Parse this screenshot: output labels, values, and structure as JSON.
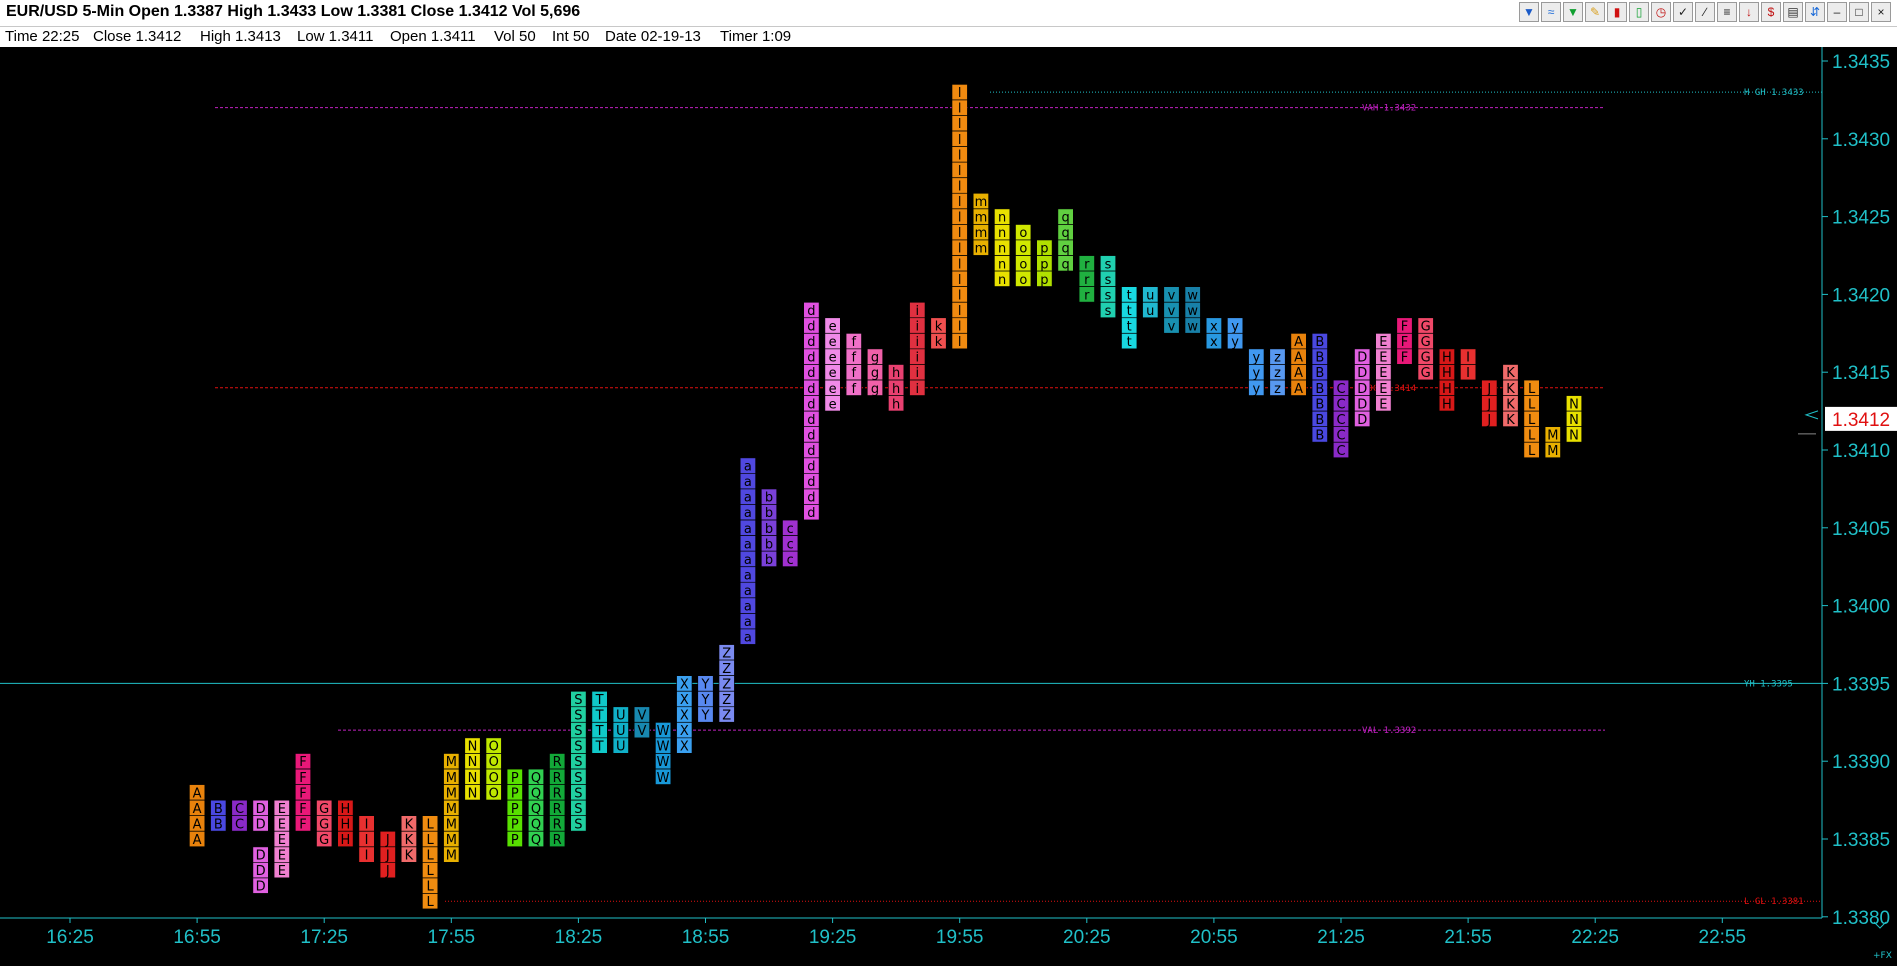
{
  "window": {
    "title": "EUR/USD 5-Min Open 1.3387 High 1.3433 Low 1.3381 Close 1.3412 Vol 5,696",
    "toolbar_icons": [
      "chart-style-icon",
      "wave-icon",
      "funnel-icon",
      "pencil-icon",
      "bars-icon",
      "candle-icon",
      "clock-icon",
      "check-tool-icon",
      "line-tool-icon",
      "fib-tool-icon",
      "arrow-down-icon",
      "dollar-icon",
      "trash-icon",
      "scroll-icon",
      "minimize-icon",
      "restore-icon",
      "close-icon"
    ]
  },
  "infobar": {
    "time": "Time 22:25",
    "close": "Close 1.3412",
    "high": "High 1.3413",
    "low": "Low 1.3411",
    "open": "Open 1.3411",
    "vol": "Vol 50",
    "int": "Int 50",
    "date": "Date 02-19-13",
    "timer": "Timer 1:09"
  },
  "chart_data": {
    "type": "table",
    "subtype": "market-profile-tpo",
    "symbol": "EUR/USD",
    "interval": "5-Min",
    "tick_size": 0.0001,
    "ylim": [
      1.3379,
      1.3436
    ],
    "y_ticks": [
      "1.3435",
      "1.3430",
      "1.3425",
      "1.3420",
      "1.3415",
      "1.3410",
      "1.3405",
      "1.3400",
      "1.3395",
      "1.3390",
      "1.3385",
      "1.3380"
    ],
    "x_ticks": [
      "16:25",
      "16:55",
      "17:25",
      "17:55",
      "18:25",
      "18:55",
      "19:25",
      "19:55",
      "20:25",
      "20:55",
      "21:25",
      "21:55",
      "22:25",
      "22:55"
    ],
    "current_price": "1.3412",
    "reference_lines": [
      {
        "label": "H GH 1.3433",
        "price": 1.3433,
        "color": "#20c0c8",
        "style": "dotted"
      },
      {
        "label": "VAH 1.3432",
        "price": 1.3432,
        "color": "#c020c0",
        "style": "dashed"
      },
      {
        "label": "POC 1.3414",
        "price": 1.3414,
        "color": "#e01010",
        "style": "dashed"
      },
      {
        "label": "YH 1.3395",
        "price": 1.3395,
        "color": "#20c0c8",
        "style": "solid"
      },
      {
        "label": "VAL 1.3392",
        "price": 1.3392,
        "color": "#c020c0",
        "style": "dashed"
      },
      {
        "label": "L GL 1.3381",
        "price": 1.3381,
        "color": "#e01010",
        "style": "dotted"
      }
    ],
    "letter_colors": {
      "A": "#e8820c",
      "B": "#4a48e0",
      "C": "#8a2ac8",
      "D": "#e060e0",
      "E": "#f080d0",
      "F": "#e81878",
      "G": "#f04868",
      "H": "#d81818",
      "I": "#e83030",
      "J": "#e02020",
      "K": "#f06a6a",
      "L": "#f08c10",
      "M": "#e8b000",
      "N": "#e8e000",
      "O": "#c0e800",
      "P": "#58e000",
      "Q": "#30d050",
      "R": "#12a838",
      "S": "#20d0a0",
      "T": "#10c8c8",
      "U": "#10b0c8",
      "V": "#1888b0",
      "W": "#1898d8",
      "X": "#3aa0f0",
      "Y": "#5888f0",
      "Z": "#7a8af0",
      "a": "#5048e0",
      "b": "#7a40d8",
      "c": "#a030d0",
      "d": "#e050e0",
      "e": "#f08ae8",
      "f": "#f070c8",
      "g": "#f060a8",
      "h": "#e84070",
      "i": "#e03040",
      "j": "#d81830",
      "k": "#f05050",
      "l": "#f08a10",
      "m": "#e8b000",
      "n": "#e8e000",
      "o": "#d0e800",
      "p": "#b0e000",
      "q": "#60d040",
      "r": "#20b040",
      "s": "#20d0b0",
      "t": "#18d8e0",
      "u": "#20b8d0",
      "v": "#1890b0",
      "w": "#1880a8",
      "x": "#2898e0",
      "y": "#4098f0",
      "z": "#5898f0"
    },
    "columns": [
      {
        "time": "16:55",
        "cells": {
          "1.3388": "A",
          "1.3387": "A",
          "1.3386": "A",
          "1.3385": "A"
        }
      },
      {
        "time": "17:00",
        "cells": {
          "1.3387": "B",
          "1.3386": "B"
        }
      },
      {
        "time": "17:05",
        "cells": {
          "1.3387": "C",
          "1.3386": "C"
        }
      },
      {
        "time": "17:10",
        "cells": {
          "1.3387": "D",
          "1.3386": "D",
          "1.3384": "D",
          "1.3383": "D",
          "1.3382": "D"
        }
      },
      {
        "time": "17:15",
        "cells": {
          "1.3387": "E",
          "1.3386": "E",
          "1.3385": "E",
          "1.3384": "E",
          "1.3383": "E"
        }
      },
      {
        "time": "17:20",
        "cells": {
          "1.3390": "F",
          "1.3389": "F",
          "1.3388": "F",
          "1.3387": "F",
          "1.3386": "F"
        }
      },
      {
        "time": "17:25",
        "cells": {
          "1.3387": "G",
          "1.3386": "G",
          "1.3385": "G"
        }
      },
      {
        "time": "17:30",
        "cells": {
          "1.3387": "H",
          "1.3386": "H",
          "1.3385": "H"
        }
      },
      {
        "time": "17:35",
        "cells": {
          "1.3386": "I",
          "1.3385": "I",
          "1.3384": "I"
        }
      },
      {
        "time": "17:40",
        "cells": {
          "1.3385": "J",
          "1.3384": "J",
          "1.3383": "J"
        }
      },
      {
        "time": "17:45",
        "cells": {
          "1.3386": "K",
          "1.3385": "K",
          "1.3384": "K"
        }
      },
      {
        "time": "17:50",
        "cells": {
          "1.3386": "L",
          "1.3385": "L",
          "1.3384": "L",
          "1.3383": "L",
          "1.3382": "L",
          "1.3381": "L"
        }
      },
      {
        "time": "17:55",
        "cells": {
          "1.3390": "M",
          "1.3389": "M",
          "1.3388": "M",
          "1.3387": "M",
          "1.3386": "M",
          "1.3385": "M",
          "1.3384": "M"
        }
      },
      {
        "time": "18:00",
        "cells": {
          "1.3391": "N",
          "1.3390": "N",
          "1.3389": "N",
          "1.3388": "N"
        }
      },
      {
        "time": "18:05",
        "cells": {
          "1.3391": "O",
          "1.3390": "O",
          "1.3389": "O",
          "1.3388": "O"
        }
      },
      {
        "time": "18:10",
        "cells": {
          "1.3389": "P",
          "1.3388": "P",
          "1.3387": "P",
          "1.3386": "P",
          "1.3385": "P"
        }
      },
      {
        "time": "18:15",
        "cells": {
          "1.3389": "Q",
          "1.3388": "Q",
          "1.3387": "Q",
          "1.3386": "Q",
          "1.3385": "Q"
        }
      },
      {
        "time": "18:20",
        "cells": {
          "1.3390": "R",
          "1.3389": "R",
          "1.3388": "R",
          "1.3387": "R",
          "1.3386": "R",
          "1.3385": "R"
        }
      },
      {
        "time": "18:25",
        "cells": {
          "1.3394": "S",
          "1.3393": "S",
          "1.3392": "S",
          "1.3391": "S",
          "1.3390": "S",
          "1.3389": "S",
          "1.3388": "S",
          "1.3387": "S",
          "1.3386": "S"
        }
      },
      {
        "time": "18:30",
        "cells": {
          "1.3394": "T",
          "1.3393": "T",
          "1.3392": "T",
          "1.3391": "T"
        }
      },
      {
        "time": "18:35",
        "cells": {
          "1.3393": "U",
          "1.3392": "U",
          "1.3391": "U"
        }
      },
      {
        "time": "18:40",
        "cells": {
          "1.3393": "V",
          "1.3392": "V"
        }
      },
      {
        "time": "18:45",
        "cells": {
          "1.3392": "W",
          "1.3391": "W",
          "1.3390": "W",
          "1.3389": "W"
        }
      },
      {
        "time": "18:50",
        "cells": {
          "1.3395": "X",
          "1.3394": "X",
          "1.3393": "X",
          "1.3392": "X",
          "1.3391": "X"
        }
      },
      {
        "time": "18:55",
        "cells": {
          "1.3395": "Y",
          "1.3394": "Y",
          "1.3393": "Y"
        }
      },
      {
        "time": "19:00",
        "cells": {
          "1.3397": "Z",
          "1.3396": "Z",
          "1.3395": "Z",
          "1.3394": "Z",
          "1.3393": "Z"
        }
      },
      {
        "time": "19:05",
        "cells": {
          "1.3409": "a",
          "1.3408": "a",
          "1.3407": "a",
          "1.3406": "a",
          "1.3405": "a",
          "1.3404": "a",
          "1.3403": "a",
          "1.3402": "a",
          "1.3401": "a",
          "1.3400": "a",
          "1.3399": "a",
          "1.3398": "a"
        }
      },
      {
        "time": "19:10",
        "cells": {
          "1.3407": "b",
          "1.3406": "b",
          "1.3405": "b",
          "1.3404": "b",
          "1.3403": "b"
        }
      },
      {
        "time": "19:15",
        "cells": {
          "1.3405": "c",
          "1.3404": "c",
          "1.3403": "c"
        }
      },
      {
        "time": "19:20",
        "cells": {
          "1.3419": "d",
          "1.3418": "d",
          "1.3417": "d",
          "1.3416": "d",
          "1.3415": "d",
          "1.3414": "d",
          "1.3413": "d",
          "1.3412": "d",
          "1.3411": "d",
          "1.3410": "d",
          "1.3409": "d",
          "1.3408": "d",
          "1.3407": "d",
          "1.3406": "d"
        }
      },
      {
        "time": "19:25",
        "cells": {
          "1.3418": "e",
          "1.3417": "e",
          "1.3416": "e",
          "1.3415": "e",
          "1.3414": "e",
          "1.3413": "e"
        }
      },
      {
        "time": "19:30",
        "cells": {
          "1.3417": "f",
          "1.3416": "f",
          "1.3415": "f",
          "1.3414": "f"
        }
      },
      {
        "time": "19:35",
        "cells": {
          "1.3416": "g",
          "1.3415": "g",
          "1.3414": "g"
        }
      },
      {
        "time": "19:40",
        "cells": {
          "1.3415": "h",
          "1.3414": "h",
          "1.3413": "h"
        }
      },
      {
        "time": "19:45",
        "cells": {
          "1.3419": "i",
          "1.3418": "i",
          "1.3417": "i",
          "1.3416": "i",
          "1.3415": "i",
          "1.3414": "i"
        }
      },
      {
        "time": "19:50",
        "cells": {
          "1.3418": "k",
          "1.3417": "k"
        }
      },
      {
        "time": "19:55",
        "cells": {
          "1.3433": "l",
          "1.3432": "l",
          "1.3431": "l",
          "1.3430": "l",
          "1.3429": "l",
          "1.3428": "l",
          "1.3427": "l",
          "1.3426": "l",
          "1.3425": "l",
          "1.3424": "l",
          "1.3423": "l",
          "1.3422": "l",
          "1.3421": "l",
          "1.3420": "l",
          "1.3419": "l",
          "1.3418": "l",
          "1.3417": "l"
        }
      },
      {
        "time": "20:00",
        "cells": {
          "1.3426": "m",
          "1.3425": "m",
          "1.3424": "m",
          "1.3423": "m"
        }
      },
      {
        "time": "20:05",
        "cells": {
          "1.3425": "n",
          "1.3424": "n",
          "1.3423": "n",
          "1.3422": "n",
          "1.3421": "n"
        }
      },
      {
        "time": "20:10",
        "cells": {
          "1.3424": "o",
          "1.3423": "o",
          "1.3422": "o",
          "1.3421": "o"
        }
      },
      {
        "time": "20:15",
        "cells": {
          "1.3423": "p",
          "1.3422": "p",
          "1.3421": "p"
        }
      },
      {
        "time": "20:20",
        "cells": {
          "1.3425": "q",
          "1.3424": "q",
          "1.3423": "q",
          "1.3422": "q"
        }
      },
      {
        "time": "20:25",
        "cells": {
          "1.3422": "r",
          "1.3421": "r",
          "1.3420": "r"
        }
      },
      {
        "time": "20:30",
        "cells": {
          "1.3422": "s",
          "1.3421": "s",
          "1.3420": "s",
          "1.3419": "s"
        }
      },
      {
        "time": "20:35",
        "cells": {
          "1.3420": "t",
          "1.3419": "t",
          "1.3418": "t",
          "1.3417": "t"
        }
      },
      {
        "time": "20:40",
        "cells": {
          "1.3420": "u",
          "1.3419": "u"
        }
      },
      {
        "time": "20:45",
        "cells": {
          "1.3420": "v",
          "1.3419": "v",
          "1.3418": "v"
        }
      },
      {
        "time": "20:50",
        "cells": {
          "1.3420": "w",
          "1.3419": "w",
          "1.3418": "w"
        }
      },
      {
        "time": "20:55",
        "cells": {
          "1.3418": "x",
          "1.3417": "x"
        }
      },
      {
        "time": "21:00",
        "cells": {
          "1.3418": "y",
          "1.3417": "y"
        }
      },
      {
        "time": "21:05",
        "cells": {
          "1.3416": "y",
          "1.3415": "y",
          "1.3414": "y"
        }
      },
      {
        "time": "21:10",
        "cells": {
          "1.3416": "z",
          "1.3415": "z",
          "1.3414": "z"
        }
      },
      {
        "time": "21:15",
        "cells": {
          "1.3417": "A",
          "1.3416": "A",
          "1.3415": "A",
          "1.3414": "A"
        }
      },
      {
        "time": "21:20",
        "cells": {
          "1.3417": "B",
          "1.3416": "B",
          "1.3415": "B",
          "1.3414": "B",
          "1.3413": "B",
          "1.3412": "B",
          "1.3411": "B"
        }
      },
      {
        "time": "21:25",
        "cells": {
          "1.3414": "C",
          "1.3413": "C",
          "1.3412": "C",
          "1.3411": "C",
          "1.3410": "C"
        }
      },
      {
        "time": "21:30",
        "cells": {
          "1.3416": "D",
          "1.3415": "D",
          "1.3414": "D",
          "1.3413": "D",
          "1.3412": "D"
        }
      },
      {
        "time": "21:35",
        "cells": {
          "1.3417": "E",
          "1.3416": "E",
          "1.3415": "E",
          "1.3414": "E",
          "1.3413": "E"
        }
      },
      {
        "time": "21:40",
        "cells": {
          "1.3418": "F",
          "1.3417": "F",
          "1.3416": "F"
        }
      },
      {
        "time": "21:45",
        "cells": {
          "1.3418": "G",
          "1.3417": "G",
          "1.3416": "G",
          "1.3415": "G"
        }
      },
      {
        "time": "21:50",
        "cells": {
          "1.3416": "H",
          "1.3415": "H",
          "1.3414": "H",
          "1.3413": "H"
        }
      },
      {
        "time": "21:55",
        "cells": {
          "1.3416": "I",
          "1.3415": "I"
        }
      },
      {
        "time": "22:00",
        "cells": {
          "1.3414": "J",
          "1.3413": "J",
          "1.3412": "J"
        }
      },
      {
        "time": "22:05",
        "cells": {
          "1.3415": "K",
          "1.3414": "K",
          "1.3413": "K",
          "1.3412": "K"
        }
      },
      {
        "time": "22:10",
        "cells": {
          "1.3414": "L",
          "1.3413": "L",
          "1.3412": "L",
          "1.3411": "L",
          "1.3410": "L"
        }
      },
      {
        "time": "22:15",
        "cells": {
          "1.3411": "M",
          "1.3410": "M"
        }
      },
      {
        "time": "22:20",
        "cells": {
          "1.3413": "N",
          "1.3412": "N",
          "1.3411": "N"
        }
      }
    ]
  },
  "footer": {
    "corner_label": "+FX"
  }
}
